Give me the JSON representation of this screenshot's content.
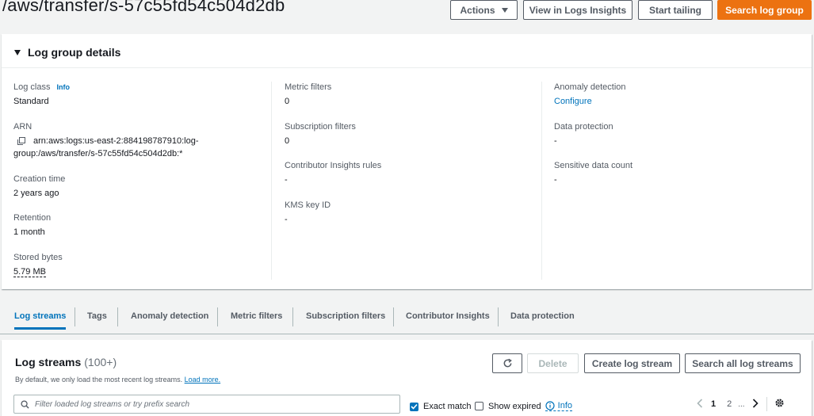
{
  "header": {
    "title": "/aws/transfer/s-57c55fd54c504d2db",
    "actions_label": "Actions",
    "view_insights_label": "View in Logs Insights",
    "start_tailing_label": "Start tailing",
    "search_log_group_label": "Search log group"
  },
  "details": {
    "heading": "Log group details",
    "log_class_label": "Log class",
    "log_class_info": "Info",
    "log_class_value": "Standard",
    "arn_label": "ARN",
    "arn_value_line1": "arn:aws:logs:us-east-2:884198787910:log-",
    "arn_value_line2": "group:/aws/transfer/s-57c55fd54c504d2db:*",
    "creation_time_label": "Creation time",
    "creation_time_value": "2 years ago",
    "retention_label": "Retention",
    "retention_value": "1 month",
    "stored_bytes_label": "Stored bytes",
    "stored_bytes_value": "5.79 MB",
    "metric_filters_label": "Metric filters",
    "metric_filters_value": "0",
    "subscription_filters_label": "Subscription filters",
    "subscription_filters_value": "0",
    "contributor_rules_label": "Contributor Insights rules",
    "contributor_rules_value": "-",
    "kms_label": "KMS key ID",
    "kms_value": "-",
    "anomaly_label": "Anomaly detection",
    "anomaly_value": "Configure",
    "data_protection_label": "Data protection",
    "data_protection_value": "-",
    "sensitive_label": "Sensitive data count",
    "sensitive_value": "-"
  },
  "tabs": [
    "Log streams",
    "Tags",
    "Anomaly detection",
    "Metric filters",
    "Subscription filters",
    "Contributor Insights",
    "Data protection"
  ],
  "streams": {
    "title": "Log streams",
    "count": "(100+)",
    "subtitle": "By default, we only load the most recent log streams.",
    "load_more": "Load more.",
    "delete_label": "Delete",
    "create_label": "Create log stream",
    "search_all_label": "Search all log streams",
    "search_placeholder": "Filter loaded log streams or try prefix search",
    "exact_match_label": "Exact match",
    "show_expired_label": "Show expired",
    "info_label": "Info",
    "page_1": "1",
    "page_2": "2",
    "ellipsis": "..."
  },
  "colors": {
    "primary": "#ec7211",
    "link": "#0073bb",
    "text": "#16191f",
    "muted": "#545b64"
  }
}
